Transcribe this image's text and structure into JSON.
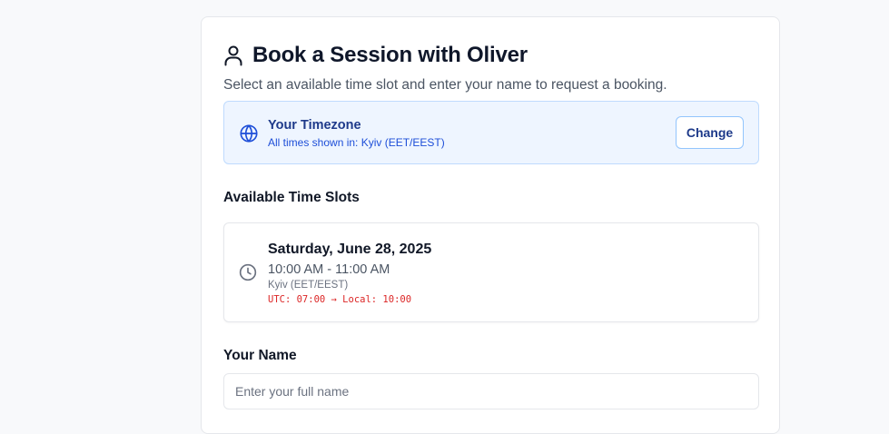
{
  "header": {
    "title": "Book a Session with Oliver",
    "subtitle": "Select an available time slot and enter your name to request a booking.",
    "icon": "user-icon"
  },
  "timezone": {
    "title": "Your Timezone",
    "description": "All times shown in: Kyiv (EET/EEST)",
    "change_label": "Change",
    "icon": "globe-icon"
  },
  "slots_section": {
    "label": "Available Time Slots",
    "slots": [
      {
        "date": "Saturday, June 28, 2025",
        "time": "10:00 AM - 11:00 AM",
        "timezone": "Kyiv (EET/EEST)",
        "debug": "UTC: 07:00 → Local: 10:00",
        "icon": "clock-icon"
      }
    ]
  },
  "name_field": {
    "label": "Your Name",
    "placeholder": "Enter your full name",
    "value": ""
  },
  "colors": {
    "accent": "#1e3a8a",
    "timezone_bg": "#eef5ff",
    "debug_text": "#dc2626"
  }
}
